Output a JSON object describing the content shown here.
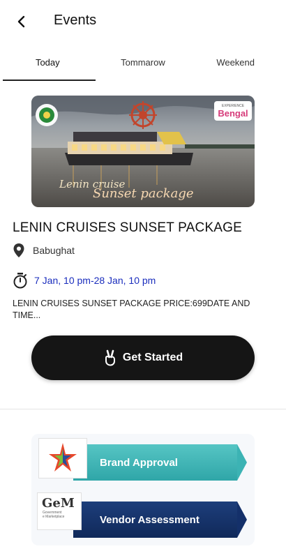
{
  "header": {
    "title": "Events"
  },
  "tabs": [
    {
      "label": "Today",
      "active": true
    },
    {
      "label": "Tommarow",
      "active": false
    },
    {
      "label": "Weekend",
      "active": false
    }
  ],
  "event": {
    "image": {
      "caption_line1": "Lenin cruise",
      "caption_line2": "Sunset package",
      "brand_badge_line1": "EXPERIENCE",
      "brand_badge_line2": "Bengal"
    },
    "title": "LENIN CRUISES SUNSET PACKAGE",
    "location": "Babughat",
    "time": "7 Jan, 10 pm-28 Jan, 10 pm",
    "description": "LENIN CRUISES SUNSET PACKAGE PRICE:699DATE AND TIME..."
  },
  "cta": {
    "label": "Get Started"
  },
  "banner": {
    "strip1": "Brand Approval",
    "strip2": "Vendor Assessment",
    "gem_line1": "GeM",
    "gem_line2": "Government",
    "gem_line3": "e Marketplace"
  },
  "colors": {
    "cta_bg": "#151515",
    "time_text": "#1a2dbd",
    "strip1": "#3cb3b4",
    "strip2": "#14306a"
  }
}
